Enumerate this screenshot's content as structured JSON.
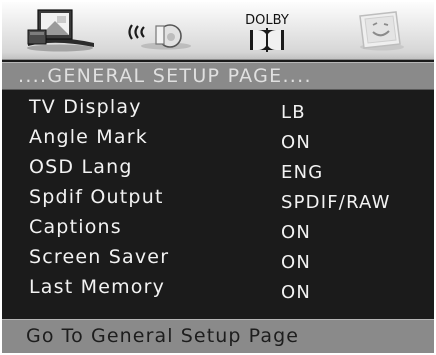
{
  "menu": {
    "tabs": [
      {
        "name": "general-setup-tab",
        "icon": "tv-display-icon",
        "selected": true
      },
      {
        "name": "audio-setup-tab",
        "icon": "speaker-sound-icon",
        "selected": false
      },
      {
        "name": "dolby-setup-tab",
        "icon": "dolby-logo-icon",
        "label": "DOLBY",
        "selected": false
      },
      {
        "name": "preference-tab",
        "icon": "smiley-face-icon",
        "selected": false
      }
    ],
    "title": "....GENERAL SETUP PAGE....",
    "items": [
      {
        "label": "TV Display",
        "value": "LB"
      },
      {
        "label": "Angle Mark",
        "value": "ON"
      },
      {
        "label": "OSD Lang",
        "value": "ENG"
      },
      {
        "label": "Spdif Output",
        "value": "SPDIF/RAW"
      },
      {
        "label": "Captions",
        "value": "ON"
      },
      {
        "label": "Screen Saver",
        "value": "ON"
      },
      {
        "label": "Last Memory",
        "value": "ON"
      }
    ],
    "status": "Go To General Setup Page"
  },
  "colors": {
    "panel": "#1b1b1b",
    "bar": "#8a8a8a",
    "text": "#f2f2f2",
    "status_text": "#1d1d1d"
  }
}
